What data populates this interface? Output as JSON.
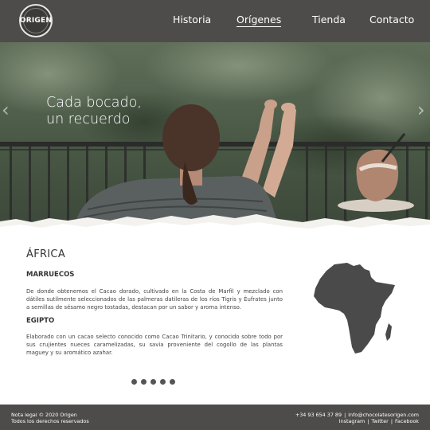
{
  "brand": {
    "logo_text": "ORIGEN"
  },
  "nav": [
    {
      "label": "Historia",
      "active": false
    },
    {
      "label": "Orígenes",
      "active": true
    },
    {
      "label": "Tienda",
      "active": false
    },
    {
      "label": "Contacto",
      "active": false
    }
  ],
  "hero": {
    "caption_line1": "Cada bocado,",
    "caption_line2": "un recuerdo",
    "prev_icon": "chevron-left-icon",
    "next_icon": "chevron-right-icon"
  },
  "content": {
    "region_title": "ÁFRICA",
    "sections": [
      {
        "title": "MARRUECOS",
        "text": "De donde obtenemos el Cacao dorado, cultivado en la Costa de Marfil y mezclado con dátiles sutilmente seleccionados de las palmeras datileras de los ríos Tigris y Éufrates junto a semillas de sésamo negro tostadas, destacan por un sabor y aroma intenso."
      },
      {
        "title": "EGIPTO",
        "text": "Elaborado con un cacao selecto conocido como Cacao Trinitario, y conocido sobre todo por sus crujientes nueces caramelizadas, su savia proveniente del cogollo de las plantas maguey y su aromático azahar."
      }
    ],
    "map_icon": "africa-map-icon",
    "carousel_dots": 5
  },
  "footer": {
    "legal_line1": "Nota legal © 2020 Origen",
    "legal_line2": "Todos los derechos reservados",
    "phone": "+34 93 654 37 89",
    "email": "info@chocolatesorigen.com",
    "social": [
      "Instagram",
      "Twitter",
      "Facebook"
    ]
  },
  "colors": {
    "header_bg": "#4e4c4a",
    "footer_bg": "#4e4c4a",
    "map_fill": "#4a4a4a",
    "text": "#333333"
  }
}
